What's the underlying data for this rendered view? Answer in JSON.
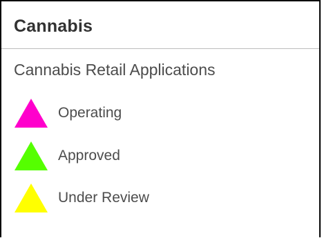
{
  "legend": {
    "layer_title": "Cannabis",
    "sublayer_title": "Cannabis Retail Applications",
    "items": [
      {
        "label": "Operating",
        "color": "#ff00cc",
        "icon": "triangle-icon"
      },
      {
        "label": "Approved",
        "color": "#55ff00",
        "icon": "triangle-icon"
      },
      {
        "label": "Under Review",
        "color": "#ffff00",
        "icon": "triangle-icon"
      }
    ]
  }
}
